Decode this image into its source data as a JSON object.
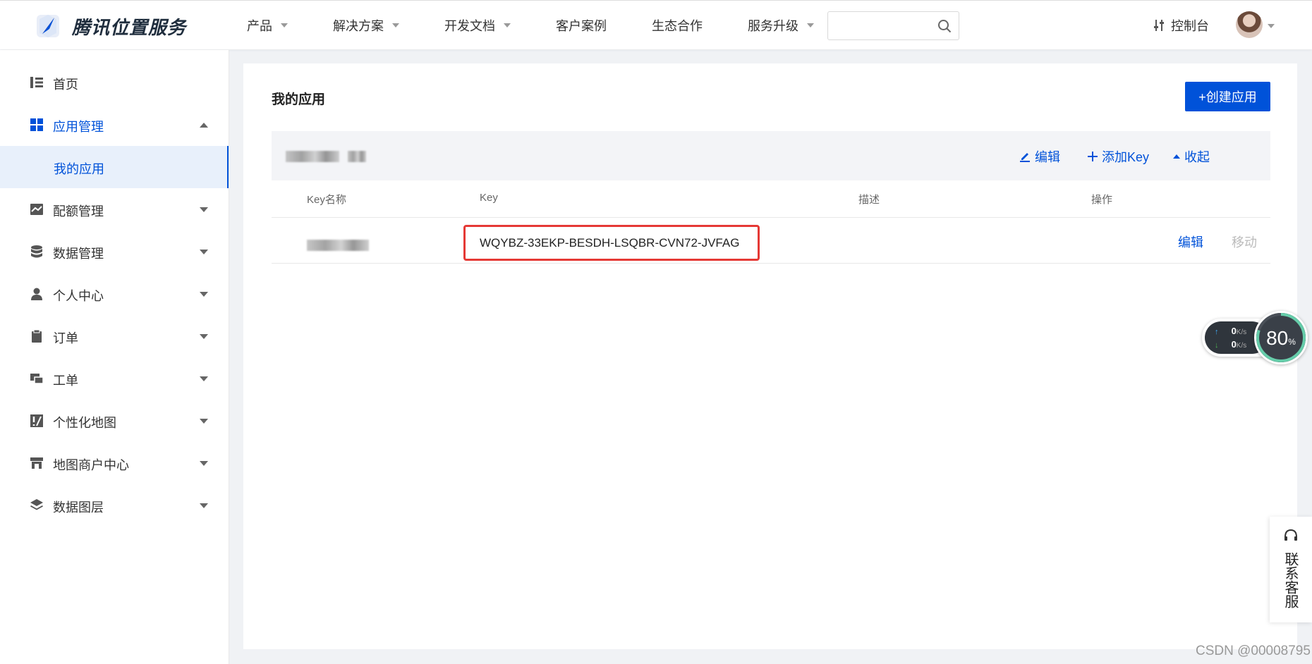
{
  "brand": {
    "name": "腾讯位置服务"
  },
  "nav": {
    "items": [
      {
        "label": "产品",
        "has_dropdown": true
      },
      {
        "label": "解决方案",
        "has_dropdown": true
      },
      {
        "label": "开发文档",
        "has_dropdown": true
      },
      {
        "label": "客户案例",
        "has_dropdown": false
      },
      {
        "label": "生态合作",
        "has_dropdown": false
      },
      {
        "label": "服务升级",
        "has_dropdown": true
      }
    ],
    "search_value": "",
    "console_label": "控制台"
  },
  "sidebar": {
    "items": [
      {
        "label": "首页",
        "icon": "home-icon"
      },
      {
        "label": "应用管理",
        "icon": "grid-icon",
        "expanded": true,
        "active": true
      },
      {
        "label": "我的应用",
        "sub": true,
        "selected": true
      },
      {
        "label": "配额管理",
        "icon": "chart-icon"
      },
      {
        "label": "数据管理",
        "icon": "database-icon"
      },
      {
        "label": "个人中心",
        "icon": "user-icon"
      },
      {
        "label": "订单",
        "icon": "clipboard-icon"
      },
      {
        "label": "工单",
        "icon": "ticket-icon"
      },
      {
        "label": "个性化地图",
        "icon": "map-style-icon"
      },
      {
        "label": "地图商户中心",
        "icon": "store-icon"
      },
      {
        "label": "数据图层",
        "icon": "layers-icon"
      }
    ]
  },
  "main": {
    "title": "我的应用",
    "create_button": "+创建应用",
    "app_actions": {
      "edit": "编辑",
      "add_key": "添加Key",
      "collapse": "收起"
    },
    "table": {
      "columns": [
        "Key名称",
        "Key",
        "描述",
        "操作"
      ],
      "rows": [
        {
          "key": "WQYBZ-33EKP-BESDH-LSQBR-CVN72-JVFAG",
          "description": "",
          "edit": "编辑",
          "move": "移动"
        }
      ]
    }
  },
  "speed_widget": {
    "up": "0",
    "down": "0",
    "unit": "K/s",
    "percent": "80",
    "percent_sign": "%"
  },
  "customer_service": {
    "label": "联系客服"
  },
  "watermark": "CSDN @00008795",
  "colors": {
    "accent": "#0052d9",
    "highlight_border": "#e53935",
    "sidebar_selected_bg": "#e8f0fb"
  }
}
